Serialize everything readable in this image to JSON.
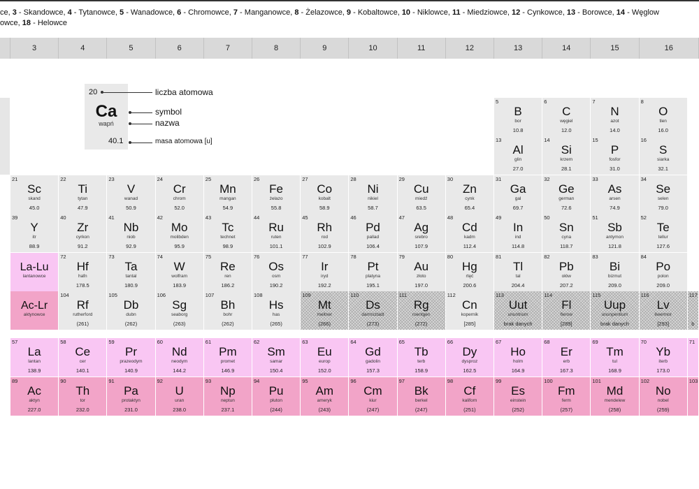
{
  "legend": {
    "line1": [
      {
        "n": "",
        "t": "ce, "
      },
      {
        "n": "3",
        "t": " - Skandowce, "
      },
      {
        "n": "4",
        "t": " - Tytanowce, "
      },
      {
        "n": "5",
        "t": " - Wanadowce, "
      },
      {
        "n": "6",
        "t": " - Chromowce, "
      },
      {
        "n": "7",
        "t": " - Manganowce, "
      },
      {
        "n": "8",
        "t": " - Żelazowce, "
      },
      {
        "n": "9",
        "t": " - Kobaltowce, "
      },
      {
        "n": "10",
        "t": " - Niklowce, "
      },
      {
        "n": "11",
        "t": " - Miedziowce, "
      },
      {
        "n": "12",
        "t": " - Cynkowce, "
      },
      {
        "n": "13",
        "t": " - Borowce, "
      },
      {
        "n": "14",
        "t": " - Węglow"
      }
    ],
    "line2": [
      {
        "n": "",
        "t": "owce, "
      },
      {
        "n": "18",
        "t": " - Helowce"
      }
    ]
  },
  "group_headers": [
    "3",
    "4",
    "5",
    "6",
    "7",
    "8",
    "9",
    "10",
    "11",
    "12",
    "13",
    "14",
    "15",
    "16"
  ],
  "key": {
    "number": "20",
    "symbol": "Ca",
    "name": "wapń",
    "mass": "40.1",
    "label_number": "liczba atomowa",
    "label_symbol": "symbol",
    "label_name": "nazwa",
    "label_mass": "masa atomowa [u]"
  },
  "main_table": [
    {
      "period": 2,
      "cells": [
        {
          "col": 12,
          "n": "5",
          "s": "B",
          "nm": "bor",
          "m": "10.8"
        },
        {
          "col": 13,
          "n": "6",
          "s": "C",
          "nm": "węgiel",
          "m": "12.0"
        },
        {
          "col": 14,
          "n": "7",
          "s": "N",
          "nm": "azot",
          "m": "14.0"
        },
        {
          "col": 15,
          "n": "8",
          "s": "O",
          "nm": "tlen",
          "m": "16.0"
        }
      ]
    },
    {
      "period": 3,
      "cells": [
        {
          "col": 12,
          "n": "13",
          "s": "Al",
          "nm": "glin",
          "m": "27.0"
        },
        {
          "col": 13,
          "n": "14",
          "s": "Si",
          "nm": "krzem",
          "m": "28.1"
        },
        {
          "col": 14,
          "n": "15",
          "s": "P",
          "nm": "fosfor",
          "m": "31.0"
        },
        {
          "col": 15,
          "n": "16",
          "s": "S",
          "nm": "siarka",
          "m": "32.1"
        }
      ]
    },
    {
      "period": 4,
      "cells": [
        {
          "col": 2,
          "n": "21",
          "s": "Sc",
          "nm": "skand",
          "m": "45.0"
        },
        {
          "col": 3,
          "n": "22",
          "s": "Ti",
          "nm": "tytan",
          "m": "47.9"
        },
        {
          "col": 4,
          "n": "23",
          "s": "V",
          "nm": "wanad",
          "m": "50.9"
        },
        {
          "col": 5,
          "n": "24",
          "s": "Cr",
          "nm": "chrom",
          "m": "52.0"
        },
        {
          "col": 6,
          "n": "25",
          "s": "Mn",
          "nm": "mangan",
          "m": "54.9"
        },
        {
          "col": 7,
          "n": "26",
          "s": "Fe",
          "nm": "żelazo",
          "m": "55.8"
        },
        {
          "col": 8,
          "n": "27",
          "s": "Co",
          "nm": "kobalt",
          "m": "58.9"
        },
        {
          "col": 9,
          "n": "28",
          "s": "Ni",
          "nm": "nikiel",
          "m": "58.7"
        },
        {
          "col": 10,
          "n": "29",
          "s": "Cu",
          "nm": "miedź",
          "m": "63.5"
        },
        {
          "col": 11,
          "n": "30",
          "s": "Zn",
          "nm": "cynk",
          "m": "65.4"
        },
        {
          "col": 12,
          "n": "31",
          "s": "Ga",
          "nm": "gal",
          "m": "69.7"
        },
        {
          "col": 13,
          "n": "32",
          "s": "Ge",
          "nm": "german",
          "m": "72.6"
        },
        {
          "col": 14,
          "n": "33",
          "s": "As",
          "nm": "arsen",
          "m": "74.9"
        },
        {
          "col": 15,
          "n": "34",
          "s": "Se",
          "nm": "selen",
          "m": "79.0"
        }
      ]
    },
    {
      "period": 5,
      "cells": [
        {
          "col": 2,
          "n": "39",
          "s": "Y",
          "nm": "itr",
          "m": "88.9"
        },
        {
          "col": 3,
          "n": "40",
          "s": "Zr",
          "nm": "cyrkon",
          "m": "91.2"
        },
        {
          "col": 4,
          "n": "41",
          "s": "Nb",
          "nm": "niob",
          "m": "92.9"
        },
        {
          "col": 5,
          "n": "42",
          "s": "Mo",
          "nm": "molibden",
          "m": "95.9"
        },
        {
          "col": 6,
          "n": "43",
          "s": "Tc",
          "nm": "technet",
          "m": "98.9"
        },
        {
          "col": 7,
          "n": "44",
          "s": "Ru",
          "nm": "ruten",
          "m": "101.1"
        },
        {
          "col": 8,
          "n": "45",
          "s": "Rh",
          "nm": "rod",
          "m": "102.9"
        },
        {
          "col": 9,
          "n": "46",
          "s": "Pd",
          "nm": "pallad",
          "m": "106.4"
        },
        {
          "col": 10,
          "n": "47",
          "s": "Ag",
          "nm": "srebro",
          "m": "107.9"
        },
        {
          "col": 11,
          "n": "48",
          "s": "Cd",
          "nm": "kadm",
          "m": "112.4"
        },
        {
          "col": 12,
          "n": "49",
          "s": "In",
          "nm": "ind",
          "m": "114.8"
        },
        {
          "col": 13,
          "n": "50",
          "s": "Sn",
          "nm": "cyna",
          "m": "118.7"
        },
        {
          "col": 14,
          "n": "51",
          "s": "Sb",
          "nm": "antymon",
          "m": "121.8"
        },
        {
          "col": 15,
          "n": "52",
          "s": "Te",
          "nm": "tellur",
          "m": "127.6"
        }
      ]
    },
    {
      "period": 6,
      "cells": [
        {
          "col": 2,
          "n": "",
          "s": "La-Lu",
          "nm": "lantanowce",
          "m": "",
          "kind": "lan",
          "rng": true
        },
        {
          "col": 3,
          "n": "72",
          "s": "Hf",
          "nm": "hafn",
          "m": "178.5"
        },
        {
          "col": 4,
          "n": "73",
          "s": "Ta",
          "nm": "tantal",
          "m": "180.9"
        },
        {
          "col": 5,
          "n": "74",
          "s": "W",
          "nm": "wolfram",
          "m": "183.9"
        },
        {
          "col": 6,
          "n": "75",
          "s": "Re",
          "nm": "ren",
          "m": "186.2"
        },
        {
          "col": 7,
          "n": "76",
          "s": "Os",
          "nm": "osm",
          "m": "190.2"
        },
        {
          "col": 8,
          "n": "77",
          "s": "Ir",
          "nm": "iryd",
          "m": "192.2"
        },
        {
          "col": 9,
          "n": "78",
          "s": "Pt",
          "nm": "platyna",
          "m": "195.1"
        },
        {
          "col": 10,
          "n": "79",
          "s": "Au",
          "nm": "złoto",
          "m": "197.0"
        },
        {
          "col": 11,
          "n": "80",
          "s": "Hg",
          "nm": "rtęć",
          "m": "200.6"
        },
        {
          "col": 12,
          "n": "81",
          "s": "Tl",
          "nm": "tal",
          "m": "204.4"
        },
        {
          "col": 13,
          "n": "82",
          "s": "Pb",
          "nm": "ołów",
          "m": "207.2"
        },
        {
          "col": 14,
          "n": "83",
          "s": "Bi",
          "nm": "bizmut",
          "m": "209.0"
        },
        {
          "col": 15,
          "n": "84",
          "s": "Po",
          "nm": "polon",
          "m": "209.0"
        }
      ]
    },
    {
      "period": 7,
      "cells": [
        {
          "col": 2,
          "n": "",
          "s": "Ac-Lr",
          "nm": "aktynowce",
          "m": "",
          "kind": "act",
          "rng": true
        },
        {
          "col": 3,
          "n": "104",
          "s": "Rf",
          "nm": "rutherford",
          "m": "(261)"
        },
        {
          "col": 4,
          "n": "105",
          "s": "Db",
          "nm": "dubn",
          "m": "(262)"
        },
        {
          "col": 5,
          "n": "106",
          "s": "Sg",
          "nm": "seaborg",
          "m": "(263)"
        },
        {
          "col": 6,
          "n": "107",
          "s": "Bh",
          "nm": "bohr",
          "m": "(262)"
        },
        {
          "col": 7,
          "n": "108",
          "s": "Hs",
          "nm": "has",
          "m": "(265)"
        },
        {
          "col": 8,
          "n": "109",
          "s": "Mt",
          "nm": "meitner",
          "m": "(266)",
          "kind": "hatch"
        },
        {
          "col": 9,
          "n": "110",
          "s": "Ds",
          "nm": "darmsztadt",
          "m": "(273)",
          "kind": "hatch"
        },
        {
          "col": 10,
          "n": "111",
          "s": "Rg",
          "nm": "roentgen",
          "m": "(272)",
          "kind": "hatch"
        },
        {
          "col": 11,
          "n": "112",
          "s": "Cn",
          "nm": "kopernik",
          "m": "[285]"
        },
        {
          "col": 12,
          "n": "113",
          "s": "Uut",
          "nm": "ununtrium",
          "m": "brak danych",
          "kind": "hatch"
        },
        {
          "col": 13,
          "n": "114",
          "s": "Fl",
          "nm": "flerow",
          "m": "[289]",
          "kind": "hatch"
        },
        {
          "col": 14,
          "n": "115",
          "s": "Uup",
          "nm": "ununpentium",
          "m": "brak danych",
          "kind": "hatch"
        },
        {
          "col": 15,
          "n": "116",
          "s": "Lv",
          "nm": "liwermor",
          "m": "[293]",
          "kind": "hatch"
        },
        {
          "col": 16,
          "n": "117",
          "s": "",
          "nm": "",
          "m": "b",
          "kind": "hatch"
        }
      ]
    }
  ],
  "lanthanides": [
    {
      "n": "57",
      "s": "La",
      "nm": "lantan",
      "m": "138.9"
    },
    {
      "n": "58",
      "s": "Ce",
      "nm": "cer",
      "m": "140.1"
    },
    {
      "n": "59",
      "s": "Pr",
      "nm": "prazeodym",
      "m": "140.9"
    },
    {
      "n": "60",
      "s": "Nd",
      "nm": "neodym",
      "m": "144.2"
    },
    {
      "n": "61",
      "s": "Pm",
      "nm": "promet",
      "m": "146.9"
    },
    {
      "n": "62",
      "s": "Sm",
      "nm": "samar",
      "m": "150.4"
    },
    {
      "n": "63",
      "s": "Eu",
      "nm": "europ",
      "m": "152.0"
    },
    {
      "n": "64",
      "s": "Gd",
      "nm": "gadolin",
      "m": "157.3"
    },
    {
      "n": "65",
      "s": "Tb",
      "nm": "terb",
      "m": "158.9"
    },
    {
      "n": "66",
      "s": "Dy",
      "nm": "dysproz",
      "m": "162.5"
    },
    {
      "n": "67",
      "s": "Ho",
      "nm": "holm",
      "m": "164.9"
    },
    {
      "n": "68",
      "s": "Er",
      "nm": "erb",
      "m": "167.3"
    },
    {
      "n": "69",
      "s": "Tm",
      "nm": "tul",
      "m": "168.9"
    },
    {
      "n": "70",
      "s": "Yb",
      "nm": "iterb",
      "m": "173.0"
    },
    {
      "n": "71",
      "s": "",
      "nm": "",
      "m": ""
    }
  ],
  "actinides": [
    {
      "n": "89",
      "s": "Ac",
      "nm": "aktyn",
      "m": "227.0"
    },
    {
      "n": "90",
      "s": "Th",
      "nm": "tor",
      "m": "232.0"
    },
    {
      "n": "91",
      "s": "Pa",
      "nm": "protaktyn",
      "m": "231.0"
    },
    {
      "n": "92",
      "s": "U",
      "nm": "uran",
      "m": "238.0"
    },
    {
      "n": "93",
      "s": "Np",
      "nm": "neptun",
      "m": "237.1"
    },
    {
      "n": "94",
      "s": "Pu",
      "nm": "pluton",
      "m": "(244)"
    },
    {
      "n": "95",
      "s": "Am",
      "nm": "ameryk",
      "m": "(243)"
    },
    {
      "n": "96",
      "s": "Cm",
      "nm": "kiur",
      "m": "(247)"
    },
    {
      "n": "97",
      "s": "Bk",
      "nm": "berkel",
      "m": "(247)"
    },
    {
      "n": "98",
      "s": "Cf",
      "nm": "kaliforn",
      "m": "(251)"
    },
    {
      "n": "99",
      "s": "Es",
      "nm": "einstein",
      "m": "(252)"
    },
    {
      "n": "100",
      "s": "Fm",
      "nm": "ferm",
      "m": "(257)"
    },
    {
      "n": "101",
      "s": "Md",
      "nm": "mendelew",
      "m": "(258)"
    },
    {
      "n": "102",
      "s": "No",
      "nm": "nobel",
      "m": "(259)"
    },
    {
      "n": "103",
      "s": "",
      "nm": "",
      "m": ""
    }
  ],
  "colors": {
    "transition": "#e9e9e9",
    "lanthanide": "#f9c6f3",
    "actinide": "#f2a4c8",
    "header": "#d9d9d9"
  }
}
